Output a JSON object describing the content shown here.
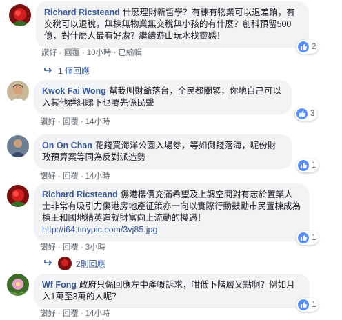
{
  "labels": {
    "like": "讚好",
    "reply": "回覆",
    "dot": "·"
  },
  "comments": [
    {
      "author": "Richard Ricsteand",
      "text": "什麼理財新哲學？有棟有物業可以退差餉，有交稅可以退稅，無棟無物業無交稅無小孩的有什麼？創科預留500億，對什麼人最有好處？繼續遊山玩水找靈感！",
      "time": "10小時",
      "edited": "已編輯",
      "likes": "2",
      "replies": "1 個回應"
    },
    {
      "author": "Kwok Fai Wong",
      "text": "幫我叫財爺落台，全民都關緊，你地自己可以入其他群組睇下乜嘢先係民聲",
      "time": "14小時",
      "likes": "3"
    },
    {
      "author": "On On Chan",
      "text": "花錢買海洋公園入場劵，等如倒錢落海，呢份財政預算案等同為反對派造勢",
      "time": "14小時",
      "likes": "1"
    },
    {
      "author": "Richard Ricsteand",
      "text": "傷港樓價充滿希望及上調空間對有志於置業人士非常有吸引力傷港房地產征策亦一向以實際行動鼓勵市民置棟成為棟王和國地精英造就財富向上流動的機遇！",
      "link": "http://i64.tinypic.com/3vj85.jpg",
      "time": "3小時",
      "likes": "1",
      "replies": "2則回應"
    },
    {
      "author": "Wf Fong",
      "text": "政府只係回應左中產嘅訴求，咁低下階層又點啊？例如月入1萬至3萬的人呢？",
      "time": "14小時",
      "likes": "1"
    }
  ],
  "colors": {
    "name": "#385898",
    "bubble": "#f2f3f5",
    "like": "#5890ff"
  }
}
